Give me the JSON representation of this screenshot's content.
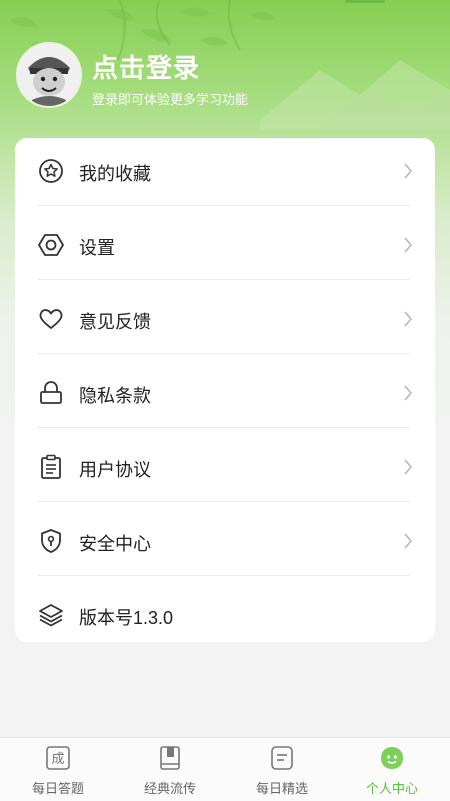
{
  "header": {
    "title": "点击登录",
    "subtitle": "登录即可体验更多学习功能",
    "avatar_icon": "cartoon-avatar-icon"
  },
  "menu": {
    "items": [
      {
        "label": "我的收藏",
        "icon": "favorite-star-icon",
        "has_arrow": true
      },
      {
        "label": "设置",
        "icon": "settings-icon",
        "has_arrow": true
      },
      {
        "label": "意见反馈",
        "icon": "heart-icon",
        "has_arrow": true
      },
      {
        "label": "隐私条款",
        "icon": "lock-icon",
        "has_arrow": true
      },
      {
        "label": "用户协议",
        "icon": "clipboard-icon",
        "has_arrow": true
      },
      {
        "label": "安全中心",
        "icon": "shield-icon",
        "has_arrow": true
      },
      {
        "label": "版本号1.3.0",
        "icon": "layers-icon",
        "has_arrow": false
      }
    ]
  },
  "tabbar": {
    "tabs": [
      {
        "label": "每日答题",
        "icon": "idiom-tile-icon",
        "active": false,
        "glyph": "成"
      },
      {
        "label": "经典流传",
        "icon": "book-icon",
        "active": false
      },
      {
        "label": "每日精选",
        "icon": "note-icon",
        "active": false
      },
      {
        "label": "个人中心",
        "icon": "profile-face-icon",
        "active": true
      }
    ]
  },
  "colors": {
    "accent": "#58c33f",
    "header_green": "#86cf52",
    "text": "#222222",
    "muted": "#666666"
  }
}
